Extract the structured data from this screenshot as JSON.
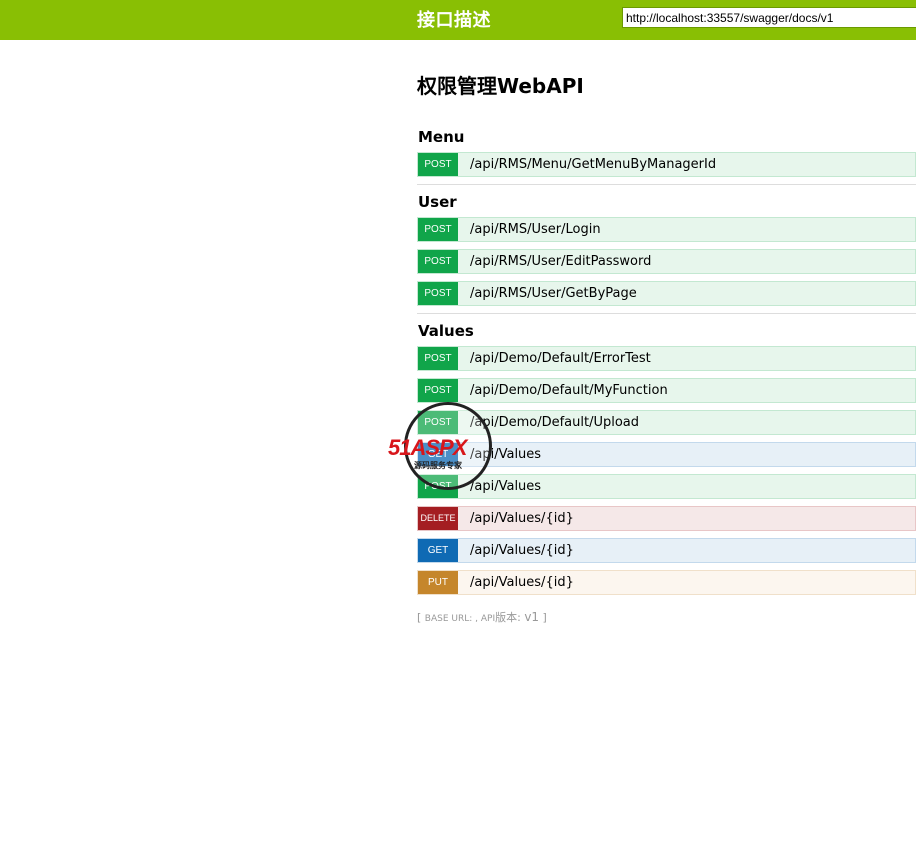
{
  "header": {
    "title": "接口描述",
    "url_value": "http://localhost:33557/swagger/docs/v1"
  },
  "api_title": "权限管理WebAPI",
  "resources": [
    {
      "name": "Menu",
      "operations": [
        {
          "method": "POST",
          "path": "/api/RMS/Menu/GetMenuByManagerId"
        }
      ]
    },
    {
      "name": "User",
      "operations": [
        {
          "method": "POST",
          "path": "/api/RMS/User/Login"
        },
        {
          "method": "POST",
          "path": "/api/RMS/User/EditPassword"
        },
        {
          "method": "POST",
          "path": "/api/RMS/User/GetByPage"
        }
      ]
    },
    {
      "name": "Values",
      "operations": [
        {
          "method": "POST",
          "path": "/api/Demo/Default/ErrorTest"
        },
        {
          "method": "POST",
          "path": "/api/Demo/Default/MyFunction"
        },
        {
          "method": "POST",
          "path": "/api/Demo/Default/Upload"
        },
        {
          "method": "GET",
          "path": "/api/Values"
        },
        {
          "method": "POST",
          "path": "/api/Values"
        },
        {
          "method": "DELETE",
          "path": "/api/Values/{id}"
        },
        {
          "method": "GET",
          "path": "/api/Values/{id}"
        },
        {
          "method": "PUT",
          "path": "/api/Values/{id}"
        }
      ]
    }
  ],
  "footer": {
    "open": "[ ",
    "base_url_label": "BASE URL: , API",
    "version_label": "版本: ",
    "version": "v1",
    "close": " ]"
  },
  "watermark": {
    "logo_text": "51ASPX",
    "sub_text": "源码服务专家"
  },
  "colors": {
    "header": "#89bf04",
    "post": "#10a54a",
    "get": "#0f6ab4",
    "delete": "#a41e22",
    "put": "#c5862b"
  }
}
